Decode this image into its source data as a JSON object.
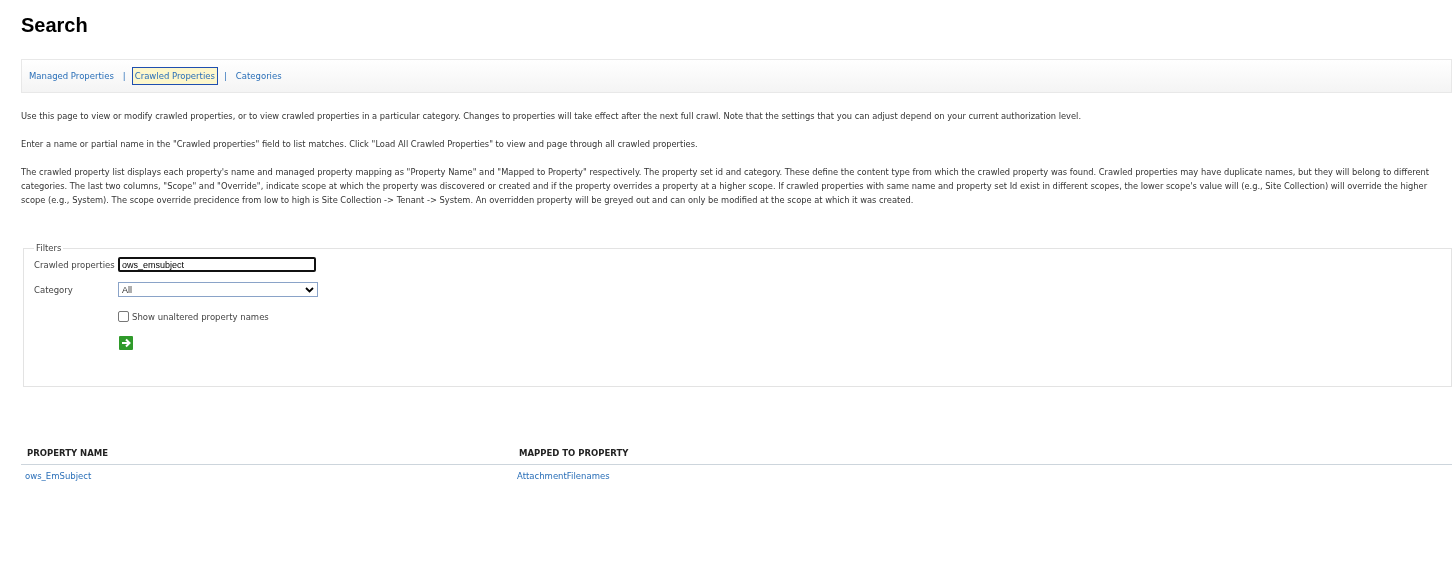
{
  "page_title": "Search",
  "nav": [
    {
      "label": "Managed Properties",
      "selected": false
    },
    {
      "label": "Crawled Properties",
      "selected": true
    },
    {
      "label": "Categories",
      "selected": false
    }
  ],
  "nav_separator": "|",
  "paragraphs": [
    "Use this page to view or modify crawled properties, or to view crawled properties in a particular category. Changes to properties will take effect after the next full crawl. Note that the settings that you can adjust depend on your current authorization level.",
    "Enter a name or partial name in the \"Crawled properties\" field to list matches. Click \"Load All Crawled Properties\" to view and page through all crawled properties.",
    "The crawled property list displays each property's name and managed property mapping as \"Property Name\" and \"Mapped to Property\" respectively. The property set id and category. These define the content type from which the crawled property was found. Crawled properties may have duplicate names, but they will belong to different categories. The last two columns, \"Scope\" and \"Override\", indicate scope at which the property was discovered or created and if the property overrides a property at a higher scope. If crawled properties with same name and property set Id exist in different scopes, the lower scope's value will (e.g., Site Collection) will override the higher scope (e.g., System). The scope override precidence from low to high is Site Collection -> Tenant -> System. An overridden property will be greyed out and can only be modified at the scope at which it was created."
  ],
  "filters": {
    "legend": "Filters",
    "crawled_properties": {
      "label": "Crawled properties",
      "value": "ows_emsubject"
    },
    "category": {
      "label": "Category",
      "value": "All"
    },
    "show_unaltered": {
      "label": "Show unaltered property names",
      "checked": false
    }
  },
  "table": {
    "columns": [
      "PROPERTY NAME",
      "MAPPED TO PROPERTY"
    ],
    "rows": [
      {
        "property_name": "ows_EmSubject",
        "mapped_to": "AttachmentFilenames"
      }
    ]
  }
}
